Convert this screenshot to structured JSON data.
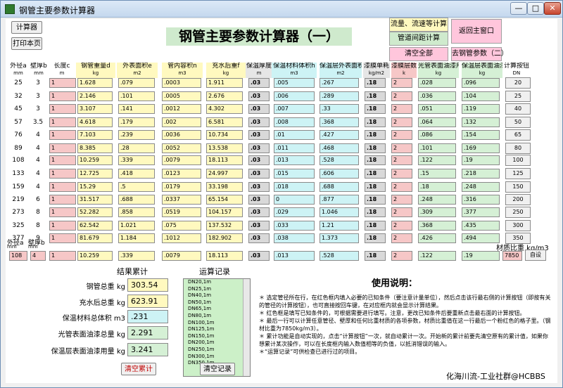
{
  "window": {
    "title": "钢管主要参数计算器",
    "min": "—",
    "max": "□",
    "close": "✕"
  },
  "main_title": "钢管主要参数计算器（一）",
  "left_buttons": {
    "calc": "计算器",
    "print": "打印本页"
  },
  "top_buttons": {
    "flow": "流量、流速等计算",
    "spacing": "管道间距计算",
    "clear_all": "清空全部",
    "back": "返回主窗口",
    "goto": "去钢管参数（二）"
  },
  "headers": [
    {
      "label": "外径a",
      "unit": "mm"
    },
    {
      "label": "壁厚b",
      "unit": "mm"
    },
    {
      "label": "长度c",
      "unit": "m"
    },
    {
      "label": "钢管重量d",
      "unit": "kg"
    },
    {
      "label": "外表面积e",
      "unit": "m2"
    },
    {
      "label": "管内容积n",
      "unit": "m3"
    },
    {
      "label": "充水后重f",
      "unit": "kg"
    },
    {
      "label": "保温厚度",
      "unit": "m"
    },
    {
      "label": "保温材料体积h",
      "unit": "m3"
    },
    {
      "label": "保温层外表面积i",
      "unit": "m2"
    },
    {
      "label": "漆膜单耗",
      "unit": "kg/m2"
    },
    {
      "label": "漆膜层数",
      "unit": "k"
    },
    {
      "label": "光管表面油漆用量L",
      "unit": "kg"
    },
    {
      "label": "保温层表面油漆用量m",
      "unit": "kg"
    },
    {
      "label": "计算按钮",
      "unit": "DN"
    }
  ],
  "rows": [
    {
      "od": "25",
      "wall": "3",
      "len": "1",
      "weight": "1.628",
      "area": ".079",
      "vol": ".0003",
      "water": "1.911",
      "ins": ".03",
      "insvol": ".005",
      "insarea": ".267",
      "paint": ".18",
      "layers": "2",
      "pipepaint": ".028",
      "inspaint": ".096",
      "dn": "20"
    },
    {
      "od": "32",
      "wall": "3",
      "len": "1",
      "weight": "2.146",
      "area": ".101",
      "vol": ".0005",
      "water": "2.676",
      "ins": ".03",
      "insvol": ".006",
      "insarea": ".289",
      "paint": ".18",
      "layers": "2",
      "pipepaint": ".036",
      "inspaint": ".104",
      "dn": "25"
    },
    {
      "od": "45",
      "wall": "3",
      "len": "1",
      "weight": "3.107",
      "area": ".141",
      "vol": ".0012",
      "water": "4.302",
      "ins": ".03",
      "insvol": ".007",
      "insarea": ".33",
      "paint": ".18",
      "layers": "2",
      "pipepaint": ".051",
      "inspaint": ".119",
      "dn": "40"
    },
    {
      "od": "57",
      "wall": "3.5",
      "len": "1",
      "weight": "4.618",
      "area": ".179",
      "vol": ".002",
      "water": "6.581",
      "ins": ".03",
      "insvol": ".008",
      "insarea": ".368",
      "paint": ".18",
      "layers": "2",
      "pipepaint": ".064",
      "inspaint": ".132",
      "dn": "50"
    },
    {
      "od": "76",
      "wall": "4",
      "len": "1",
      "weight": "7.103",
      "area": ".239",
      "vol": ".0036",
      "water": "10.734",
      "ins": ".03",
      "insvol": ".01",
      "insarea": ".427",
      "paint": ".18",
      "layers": "2",
      "pipepaint": ".086",
      "inspaint": ".154",
      "dn": "65"
    },
    {
      "od": "89",
      "wall": "4",
      "len": "1",
      "weight": "8.385",
      "area": ".28",
      "vol": ".0052",
      "water": "13.538",
      "ins": ".03",
      "insvol": ".011",
      "insarea": ".468",
      "paint": ".18",
      "layers": "2",
      "pipepaint": ".101",
      "inspaint": ".169",
      "dn": "80"
    },
    {
      "od": "108",
      "wall": "4",
      "len": "1",
      "weight": "10.259",
      "area": ".339",
      "vol": ".0079",
      "water": "18.113",
      "ins": ".03",
      "insvol": ".013",
      "insarea": ".528",
      "paint": ".18",
      "layers": "2",
      "pipepaint": ".122",
      "inspaint": ".19",
      "dn": "100"
    },
    {
      "od": "133",
      "wall": "4",
      "len": "1",
      "weight": "12.725",
      "area": ".418",
      "vol": ".0123",
      "water": "24.997",
      "ins": ".03",
      "insvol": ".015",
      "insarea": ".606",
      "paint": ".18",
      "layers": "2",
      "pipepaint": ".15",
      "inspaint": ".218",
      "dn": "125"
    },
    {
      "od": "159",
      "wall": "4",
      "len": "1",
      "weight": "15.29",
      "area": ".5",
      "vol": ".0179",
      "water": "33.198",
      "ins": ".03",
      "insvol": ".018",
      "insarea": ".688",
      "paint": ".18",
      "layers": "2",
      "pipepaint": ".18",
      "inspaint": ".248",
      "dn": "150"
    },
    {
      "od": "219",
      "wall": "6",
      "len": "1",
      "weight": "31.517",
      "area": ".688",
      "vol": ".0337",
      "water": "65.154",
      "ins": ".03",
      "insvol": "0",
      "insarea": ".877",
      "paint": ".18",
      "layers": "2",
      "pipepaint": ".248",
      "inspaint": ".316",
      "dn": "200"
    },
    {
      "od": "273",
      "wall": "8",
      "len": "1",
      "weight": "52.282",
      "area": ".858",
      "vol": ".0519",
      "water": "104.157",
      "ins": ".03",
      "insvol": ".029",
      "insarea": "1.046",
      "paint": ".18",
      "layers": "2",
      "pipepaint": ".309",
      "inspaint": ".377",
      "dn": "250"
    },
    {
      "od": "325",
      "wall": "8",
      "len": "1",
      "weight": "62.542",
      "area": "1.021",
      "vol": ".075",
      "water": "137.532",
      "ins": ".03",
      "insvol": ".033",
      "insarea": "1.21",
      "paint": ".18",
      "layers": "2",
      "pipepaint": ".368",
      "inspaint": ".435",
      "dn": "300"
    },
    {
      "od": "377",
      "wall": "9",
      "len": "1",
      "weight": "81.679",
      "area": "1.184",
      "vol": ".1012",
      "water": "182.902",
      "ins": ".03",
      "insvol": ".038",
      "insarea": "1.373",
      "paint": ".18",
      "layers": "2",
      "pipepaint": ".426",
      "inspaint": ".494",
      "dn": "350"
    }
  ],
  "custom": {
    "od_label": "外径a",
    "od_unit": "mm",
    "wall_label": "壁厚b",
    "wall_unit": "mm",
    "od": "108",
    "wall": "4",
    "len": "1",
    "weight": "10.259",
    "area": ".339",
    "vol": ".0079",
    "water": "18.113",
    "ins": ".03",
    "insvol": ".013",
    "insarea": ".528",
    "paint": ".18",
    "layers": "2",
    "pipepaint": ".122",
    "inspaint": ".19",
    "density_label": "材质比重 kg/m3",
    "density": "7850",
    "set_button": "自设"
  },
  "totals": {
    "title": "结果累计",
    "items": [
      {
        "label": "钢管总重 kg",
        "value": "303.54"
      },
      {
        "label": "充水后总重 kg",
        "value": "623.91"
      },
      {
        "label": "保温材料总体积 m3",
        "value": ".231"
      },
      {
        "label": "光管表面油漆总量 kg",
        "value": "2.291"
      },
      {
        "label": "保温层表面油漆用量 kg",
        "value": "3.241"
      }
    ],
    "clear_button": "清空累计"
  },
  "log": {
    "title": "运算记录",
    "entries": [
      "DN20,1m",
      "DN25,1m",
      "DN40,1m",
      "DN50,1m",
      "DN65,1m",
      "DN80,1m",
      "DN100,1m",
      "DN125,1m",
      "DN150,1m",
      "DN200,1m",
      "DN250,1m",
      "DN300,1m",
      "DN350,1m"
    ],
    "clear_button": "清空记录"
  },
  "help": {
    "title": "使用说明：",
    "lines": [
      "＊ 选定管径所在行，在红色框内填入必要的已知条件（要注意计量单位），然后点击该行最右侧的计算按钮（即按有关的管径的计算按钮），也可直接按回车键，在对应框内就会显示计算结果。",
      "＊ 红色框是填写已知条件的，可根据需要进行填写。注意，更改已知条件后要重新点击最右面的计算按钮。",
      "＊ 最后一行可以计算任意管径、壁厚和任何比重材质的各项参数，材质比重值在这一行最后一个粉红色的格子里。（钢材比重为7850kg/m3）。",
      "＊ 累计功能是自动实现的，点击“计算按钮”一次，就自动累计一次。开始新的累计前要先清空原有的累计值，如果你想累计某次操作，可以在长度框内输入数值相等的负值，以抵消错误的输入。",
      "＊“运算记录”可供检查已进行过的项目。"
    ]
  },
  "watermark": "化海川流-工业社群@HCBBS"
}
